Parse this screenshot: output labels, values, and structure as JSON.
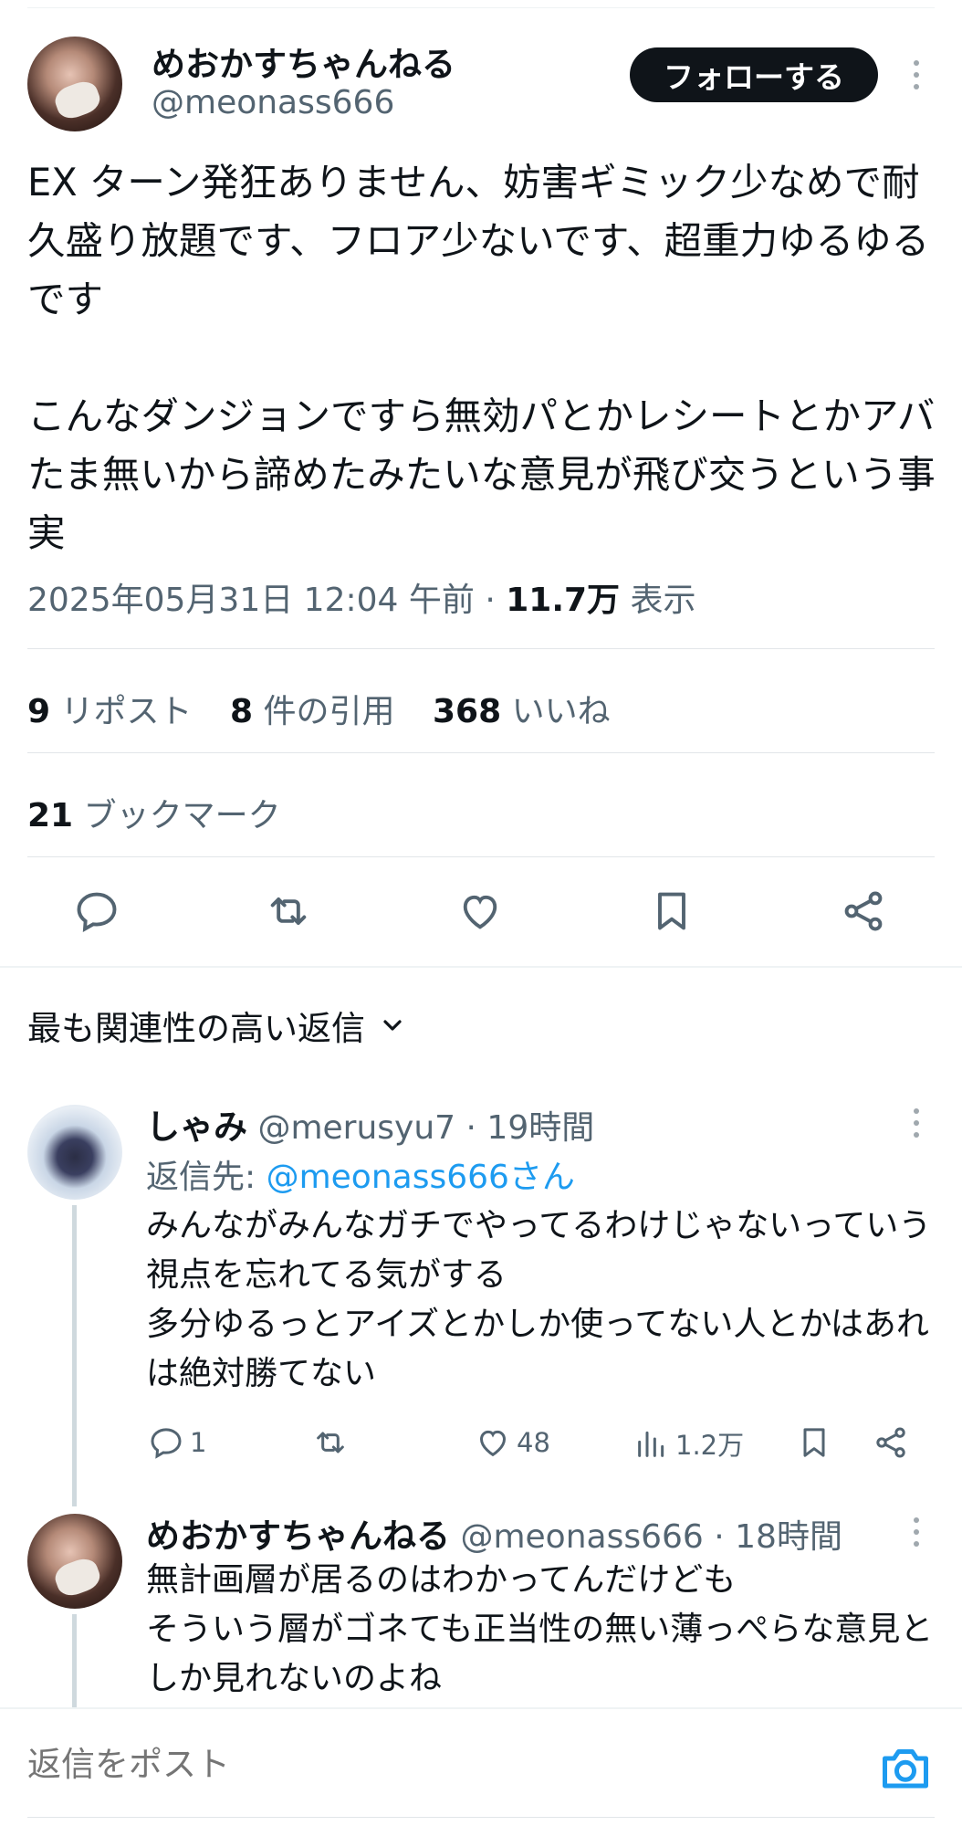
{
  "tweet": {
    "author_name": "めおかすちゃんねる",
    "author_handle": "@meonass666",
    "follow_label": "フォローする",
    "text": "EX ターン発狂ありません、妨害ギミック少なめで耐久盛り放題です、フロア少ないです、超重力ゆるゆるです\n\nこんなダンジョンですら無効パとかレシートとかアバたま無いから諦めたみたいな意見が飛び交うという事実",
    "timestamp": "2025年05月31日 12:04 午前",
    "views_count": "11.7万",
    "views_label": "表示"
  },
  "stats": {
    "reposts_count": "9",
    "reposts_label": "リポスト",
    "quotes_count": "8",
    "quotes_label": "件の引用",
    "likes_count": "368",
    "likes_label": "いいね",
    "bookmarks_count": "21",
    "bookmarks_label": "ブックマーク"
  },
  "replies_sort": {
    "label": "最も関連性の高い返信"
  },
  "replies": [
    {
      "name": "しゃみ",
      "handle": "@merusyu7",
      "time": "· 19時間",
      "reply_to_prefix": "返信先: ",
      "reply_to_handle": "@meonass666さん",
      "text": "みんながみんなガチでやってるわけじゃないっていう視点を忘れてる気がする\n多分ゆるっとアイズとかしか使ってない人とかはあれは絶対勝てない",
      "reply_count": "1",
      "like_count": "48",
      "view_count": "1.2万"
    },
    {
      "name": "めおかすちゃんねる",
      "handle": "@meonass666",
      "time": "· 18時間",
      "text": "無計画層が居るのはわかってんだけども\nそういう層がゴネても正当性の無い薄っぺらな意見としか見れないのよね"
    }
  ],
  "compose": {
    "placeholder": "返信をポスト"
  },
  "colors": {
    "text_primary": "#0f1419",
    "text_secondary": "#536471",
    "accent_blue": "#1d9bf0",
    "follow_button_bg": "#0f1419"
  },
  "icons": [
    "more-icon",
    "reply-icon",
    "repost-icon",
    "like-icon",
    "bookmark-icon",
    "share-icon",
    "chevron-down-icon",
    "views-icon",
    "camera-icon"
  ]
}
